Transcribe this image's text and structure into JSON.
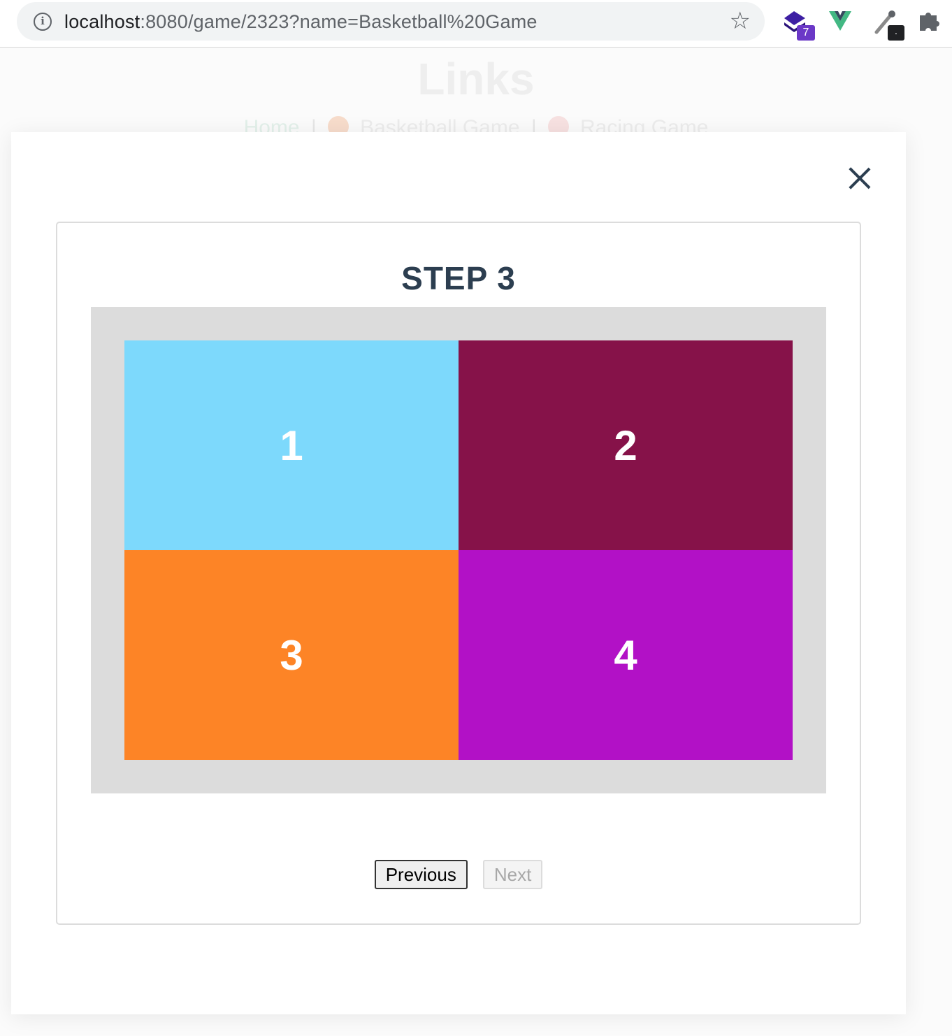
{
  "browser": {
    "url_host": "localhost",
    "url_path": ":8080/game/2323?name=Basketball%20Game",
    "extensions": [
      {
        "name": "stack-extension-icon",
        "badge": "7"
      },
      {
        "name": "vue-devtools-icon"
      },
      {
        "name": "eyedropper-extension-icon",
        "badge": "."
      },
      {
        "name": "puzzle-extensions-icon"
      }
    ]
  },
  "background": {
    "title": "Links",
    "links": [
      {
        "label": "Home"
      },
      {
        "label": "Basketball Game",
        "icon": "basketball-icon"
      },
      {
        "label": "Racing Game",
        "icon": "racing-icon"
      }
    ],
    "separator": "|"
  },
  "modal": {
    "step_title": "STEP 3",
    "zones": [
      {
        "label": "1",
        "color": "#7dd9fc"
      },
      {
        "label": "2",
        "color": "#861249"
      },
      {
        "label": "3",
        "color": "#fd8426"
      },
      {
        "label": "4",
        "color": "#b211c6"
      }
    ],
    "court_color": "#dcdcdc",
    "previous_label": "Previous",
    "next_label": "Next"
  },
  "colors": {
    "text": "#2c3e50",
    "extension_purple": "#6b38c7",
    "vue_green": "#42b883"
  }
}
